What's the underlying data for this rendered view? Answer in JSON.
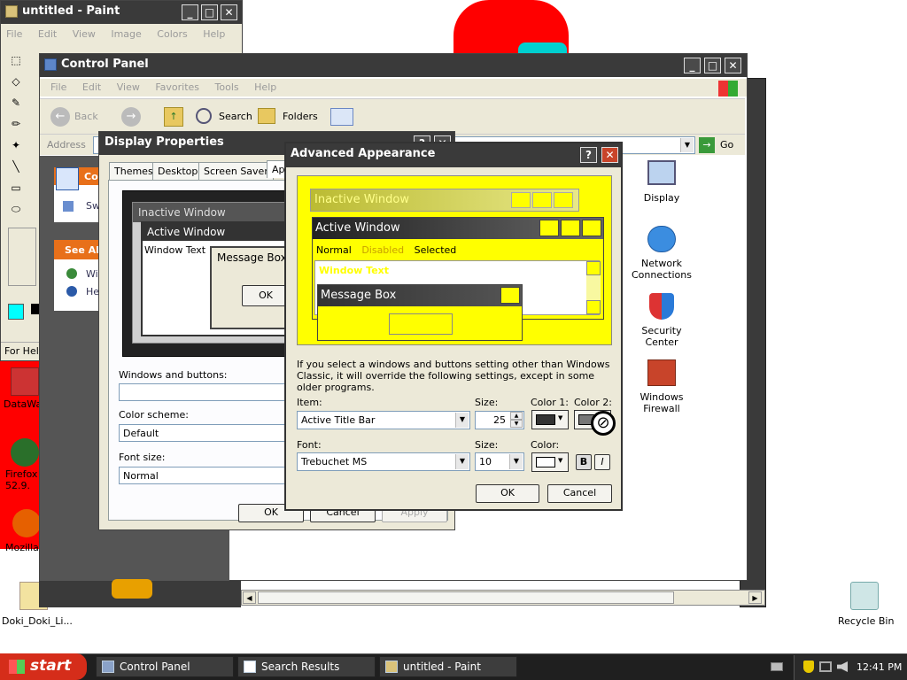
{
  "colors": {
    "taskbar": "#1f1f1f",
    "start": "#d52d1a",
    "titlebar": "#3a3a3a",
    "preview_yellow": "#ffff00",
    "desktop_red": "#ff0000"
  },
  "paint": {
    "title": "untitled - Paint",
    "menu": [
      "File",
      "Edit",
      "View",
      "Image",
      "Colors",
      "Help"
    ],
    "status": "For Help"
  },
  "control_panel": {
    "title": "Control Panel",
    "menu": [
      "File",
      "Edit",
      "View",
      "Favorites",
      "Tools",
      "Help"
    ],
    "toolbar": {
      "back": "Back",
      "search": "Search",
      "folders": "Folders"
    },
    "address_label": "Address",
    "go": "Go",
    "side": {
      "header1": "Co",
      "item1": "Sw",
      "header2": "See Al",
      "item2": "Wi",
      "item3": "He"
    },
    "icons": [
      {
        "label": "Display",
        "icon": "display-icon"
      },
      {
        "label": "Network\nConnections",
        "icon": "network-icon"
      },
      {
        "label": "Security\nCenter",
        "icon": "shield-icon"
      },
      {
        "label": "Windows\nFirewall",
        "icon": "firewall-icon"
      }
    ]
  },
  "display_props": {
    "title": "Display Properties",
    "tabs": [
      "Themes",
      "Desktop",
      "Screen Saver",
      "App"
    ],
    "preview": {
      "inactive": "Inactive Window",
      "active": "Active Window",
      "window_text": "Window Text",
      "message_box": "Message Box",
      "ok": "OK"
    },
    "windows_buttons_label": "Windows and buttons:",
    "windows_buttons_value": "",
    "color_scheme_label": "Color scheme:",
    "color_scheme_value": "Default",
    "font_size_label": "Font size:",
    "font_size_value": "Normal",
    "ok": "OK",
    "cancel": "Cancel",
    "apply": "Apply"
  },
  "advanced": {
    "title": "Advanced Appearance",
    "preview": {
      "inactive": "Inactive Window",
      "active": "Active Window",
      "normal": "Normal",
      "disabled": "Disabled",
      "selected": "Selected",
      "window_text": "Window Text",
      "message_box": "Message Box"
    },
    "note": "If you select a windows and buttons setting other than Windows Classic, it will override the following settings, except in some older programs.",
    "item_label": "Item:",
    "item_value": "Active Title Bar",
    "size_label": "Size:",
    "size_value": "25",
    "color1_label": "Color 1:",
    "color2_label": "Color 2:",
    "font_label": "Font:",
    "font_value": "Trebuchet MS",
    "font_size_label": "Size:",
    "font_size_value": "10",
    "font_color_label": "Color:",
    "bold": "B",
    "italic": "I",
    "ok": "OK",
    "cancel": "Cancel"
  },
  "desktop": {
    "icons": [
      {
        "label": "DataWa",
        "icon": "app-icon"
      },
      {
        "label": "Firefox\n52.9.",
        "icon": "firefox-icon"
      },
      {
        "label": "Mozilla F",
        "icon": "firefox-icon"
      },
      {
        "label": "Doki_Doki_Li...",
        "icon": "zip-icon"
      },
      {
        "label": "Recycle Bin",
        "icon": "recycle-bin-icon"
      }
    ]
  },
  "taskbar": {
    "start": "start",
    "tasks": [
      "Control Panel",
      "Search Results",
      "untitled - Paint"
    ],
    "clock": "12:41 PM"
  }
}
